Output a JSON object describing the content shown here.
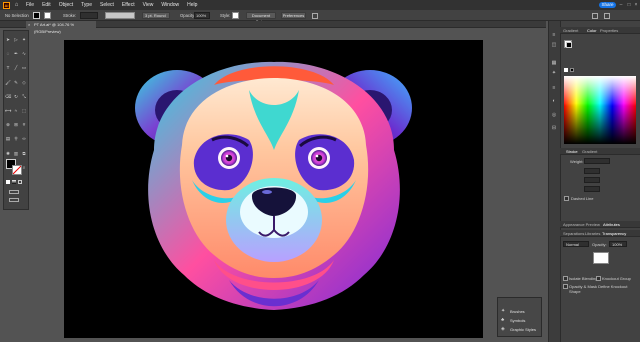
{
  "menubar": {
    "logo": "Ai",
    "items": [
      "File",
      "Edit",
      "Object",
      "Type",
      "Select",
      "Effect",
      "View",
      "Window",
      "Help"
    ],
    "share_label": "Share"
  },
  "control_bar": {
    "selection_label": "No Selection",
    "stroke_label": "Stroke:",
    "brush_value": "3 pt. Round",
    "opacity_label": "Opacity:",
    "opacity_value": "100%",
    "style_label": "Style:",
    "document_setup_label": "Document Setup",
    "preferences_label": "Preferences"
  },
  "document_tab": {
    "title": "PT Art.ai* @ 104.76 % (RGB/Preview)",
    "close_glyph": "×"
  },
  "right_panel": {
    "top_tabs": [
      "Gradient",
      "Color",
      "Properties"
    ],
    "stroke_section": {
      "tabs": [
        "Stroke",
        "Gradient"
      ],
      "weight_label": "Weight:",
      "dashed_line_label": "Dashed Line"
    },
    "transparency_section": {
      "tabs_row1": [
        "Appearance Preview",
        "Attributes"
      ],
      "tabs_row2": [
        "Separations",
        "Libraries",
        "Transparency"
      ],
      "blend_mode": "Normal",
      "opacity_label": "Opacity:",
      "opacity_value": "100%",
      "isolate_blending_label": "Isolate Blending",
      "knockout_group_label": "Knockout Group",
      "opacity_mask_label": "Opacity & Mask Define Knockout Shape"
    }
  },
  "flyout_panel": {
    "items": [
      "Brushes",
      "Symbols",
      "Graphic Styles"
    ]
  },
  "colors": {
    "accent": "#1473e6",
    "canvas": "#000000",
    "panel_bg": "#424242",
    "workspace": "#535353"
  }
}
